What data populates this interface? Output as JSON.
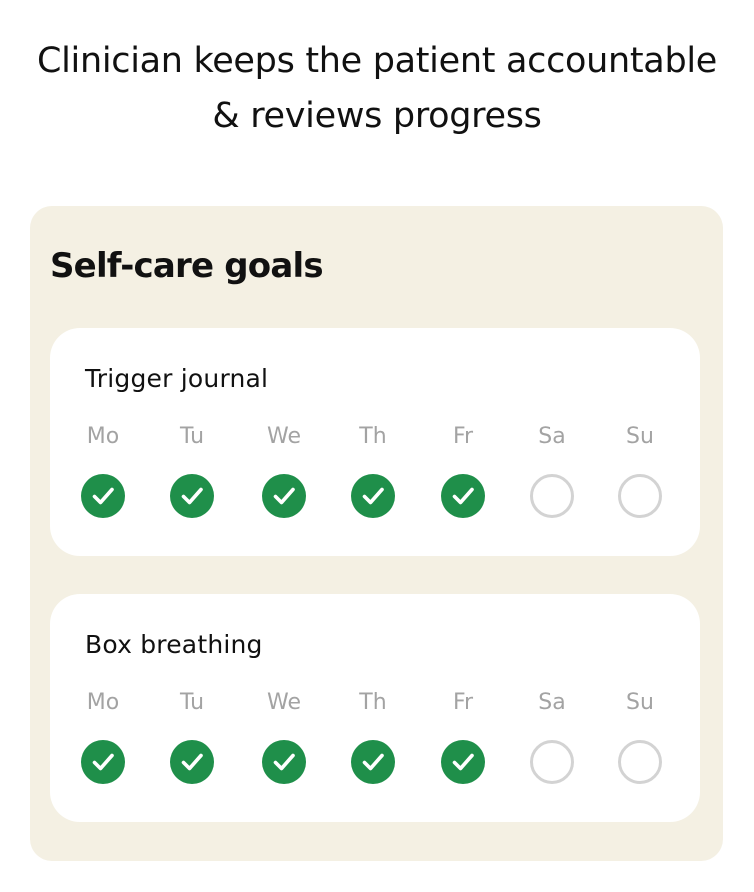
{
  "headline": {
    "line1": "Clinician keeps the patient accountable",
    "line2": "& reviews progress"
  },
  "panel": {
    "title": "Self-care goals"
  },
  "colors": {
    "done": "#1f8f4a",
    "todo_ring": "#d3d3d3",
    "panel_bg": "#f4f0e3"
  },
  "goals": [
    {
      "name": "Trigger journal",
      "days": [
        {
          "label": "Mo",
          "done": true
        },
        {
          "label": "Tu",
          "done": true
        },
        {
          "label": "We",
          "done": true
        },
        {
          "label": "Th",
          "done": true
        },
        {
          "label": "Fr",
          "done": true
        },
        {
          "label": "Sa",
          "done": false
        },
        {
          "label": "Su",
          "done": false
        }
      ]
    },
    {
      "name": "Box breathing",
      "days": [
        {
          "label": "Mo",
          "done": true
        },
        {
          "label": "Tu",
          "done": true
        },
        {
          "label": "We",
          "done": true
        },
        {
          "label": "Th",
          "done": true
        },
        {
          "label": "Fr",
          "done": true
        },
        {
          "label": "Sa",
          "done": false
        },
        {
          "label": "Su",
          "done": false
        }
      ]
    }
  ]
}
